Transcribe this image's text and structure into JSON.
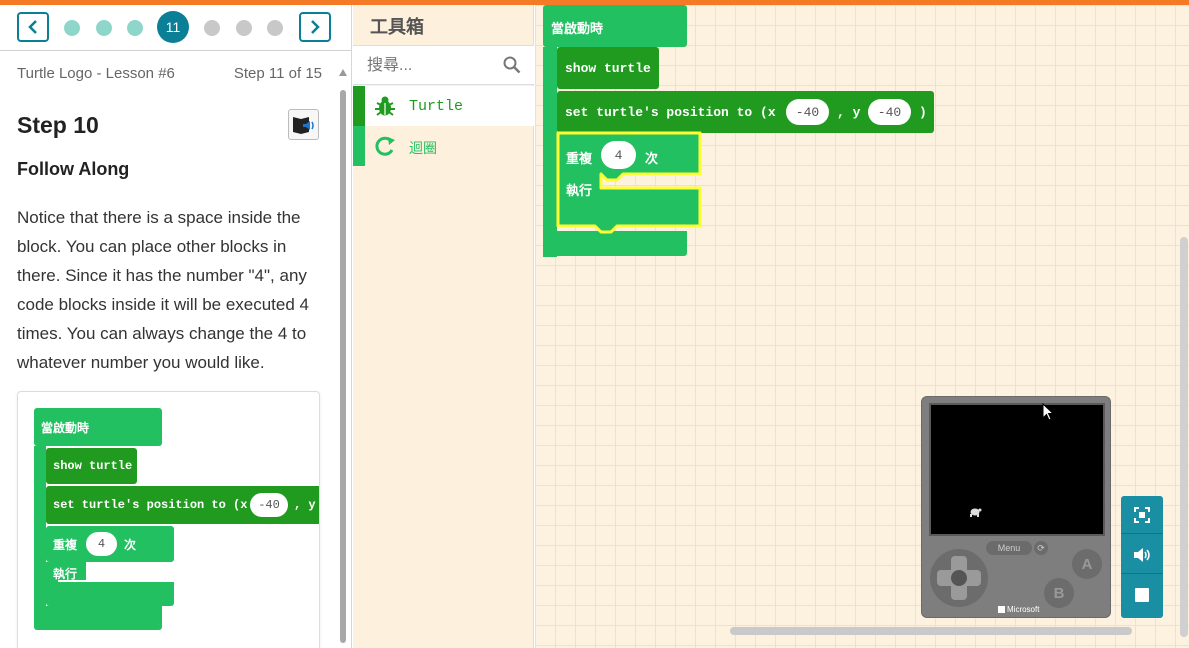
{
  "colors": {
    "accent_bar": "#f47a25",
    "nav_teal": "#0b7f95",
    "block_events": "#23c062",
    "block_turtle": "#209b20",
    "block_highlight": "#ffff00",
    "toolbox_bg": "#fdf0dc"
  },
  "stepper": {
    "prev_icon": "chevron-left-icon",
    "next_icon": "chevron-right-icon",
    "current_step_number": "11",
    "dots_before": 3,
    "dots_after": 3
  },
  "lesson": {
    "title": "Turtle Logo - Lesson #6",
    "step_counter": "Step 11 of 15"
  },
  "step": {
    "title": "Step 10",
    "subtitle": "Follow Along",
    "body": "Notice that there is a space inside the block. You can place other blocks in there. Since it has the number \"4\", any code blocks inside it will be executed 4 times. You can always change the 4 to whatever number you would like."
  },
  "toolbox": {
    "title": "工具箱",
    "search_placeholder": "搜尋...",
    "categories": [
      {
        "label": "Turtle",
        "icon": "bug-icon",
        "color": "#209b20"
      },
      {
        "label": "迴圈",
        "icon": "loop-icon",
        "color": "#23c062"
      }
    ]
  },
  "blocks": {
    "on_start": "當啟動時",
    "show_turtle": "show turtle",
    "set_position_prefix": "set turtle's position to (x",
    "x_value": "-40",
    "y_label": ", y",
    "y_value": "-40",
    "close_paren": ")",
    "repeat": "重複",
    "repeat_times": "4",
    "times_suffix": "次",
    "do": "執行"
  },
  "simulator": {
    "menu_label": "Menu",
    "brand": "Microsoft",
    "button_a": "A",
    "button_b": "B"
  },
  "sidetools": [
    "fullscreen-icon",
    "sound-icon",
    "stop-icon"
  ]
}
